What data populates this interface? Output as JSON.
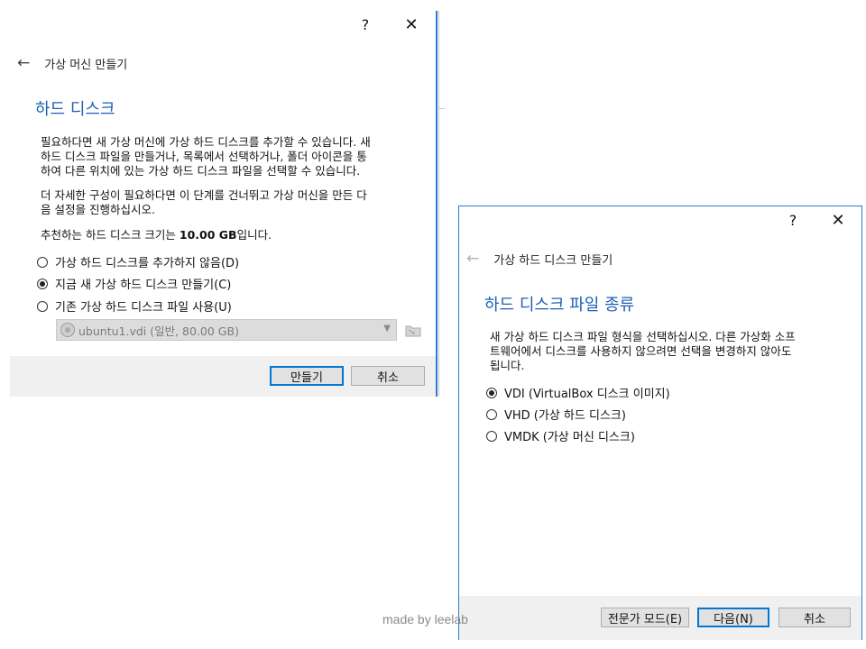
{
  "dialog_create_vm": {
    "titlebar": {
      "help": "?",
      "close": "✕"
    },
    "nav_title": "가상 머신 만들기",
    "section_title": "하드 디스크",
    "desc1": [
      "필요하다면 새 가상 머신에 가상 하드 디스크를 추가할 수 있습니다. 새",
      "하드 디스크 파일을 만들거나, 목록에서 선택하거나, 폴더 아이콘을 통",
      "하여 다른 위치에 있는 가상 하드 디스크 파일을 선택할 수 있습니다."
    ],
    "desc2": [
      "더 자세한 구성이 필요하다면 이 단계를 건너뛰고 가상 머신을 만든 다",
      "음 설정을 진행하십시오."
    ],
    "recommend_prefix": "추천하는 하드 디스크 크기는 ",
    "recommend_size": "10.00 GB",
    "recommend_suffix": "입니다.",
    "options": [
      {
        "label": "가상 하드 디스크를 추가하지 않음(D)",
        "checked": false
      },
      {
        "label": "지금 새 가상 하드 디스크 만들기(C)",
        "checked": true
      },
      {
        "label": "기존 가상 하드 디스크 파일 사용(U)",
        "checked": false
      }
    ],
    "existing_file": "ubuntu1.vdi (일반, 80.00 GB)",
    "buttons": {
      "create": "만들기",
      "cancel": "취소"
    }
  },
  "dialog_create_disk": {
    "titlebar": {
      "help": "?",
      "close": "✕"
    },
    "nav_title": "가상 하드 디스크 만들기",
    "section_title": "하드 디스크 파일 종류",
    "desc": [
      "새 가상 하드 디스크 파일 형식을 선택하십시오. 다른 가상화 소프",
      "트웨어에서 디스크를 사용하지 않으려면 선택을 변경하지 않아도",
      "됩니다."
    ],
    "options": [
      {
        "label": "VDI (VirtualBox 디스크 이미지)",
        "checked": true
      },
      {
        "label": "VHD (가상 하드 디스크)",
        "checked": false
      },
      {
        "label": "VMDK (가상 머신 디스크)",
        "checked": false
      }
    ],
    "buttons": {
      "expert": "전문가 모드(E)",
      "next": "다음(N)",
      "cancel": "취소"
    }
  },
  "watermark": "made by leelab",
  "colors": {
    "accent": "#1d5fb5",
    "focus_border": "#0078d7",
    "footer_bg": "#f0f0f0"
  },
  "icons": [
    "back-arrow-icon",
    "help-icon",
    "close-icon",
    "radio-icon",
    "dropdown-arrow-icon",
    "folder-icon",
    "disk-icon"
  ]
}
